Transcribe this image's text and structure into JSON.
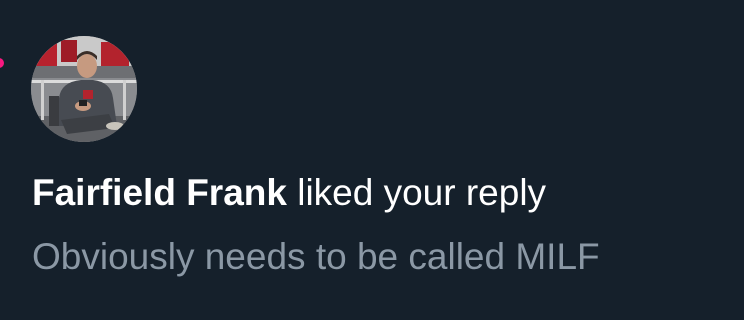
{
  "notification": {
    "actor_name": "Fairfield Frank",
    "action_text": " liked your reply",
    "reply_text": "Obviously needs to be called MILF",
    "avatar_icon": "person-on-phone-photo",
    "like_icon": "heart-icon"
  },
  "colors": {
    "background": "#15202b",
    "primary_text": "#ffffff",
    "secondary_text": "#8b98a5",
    "like_accent": "#f91880"
  }
}
